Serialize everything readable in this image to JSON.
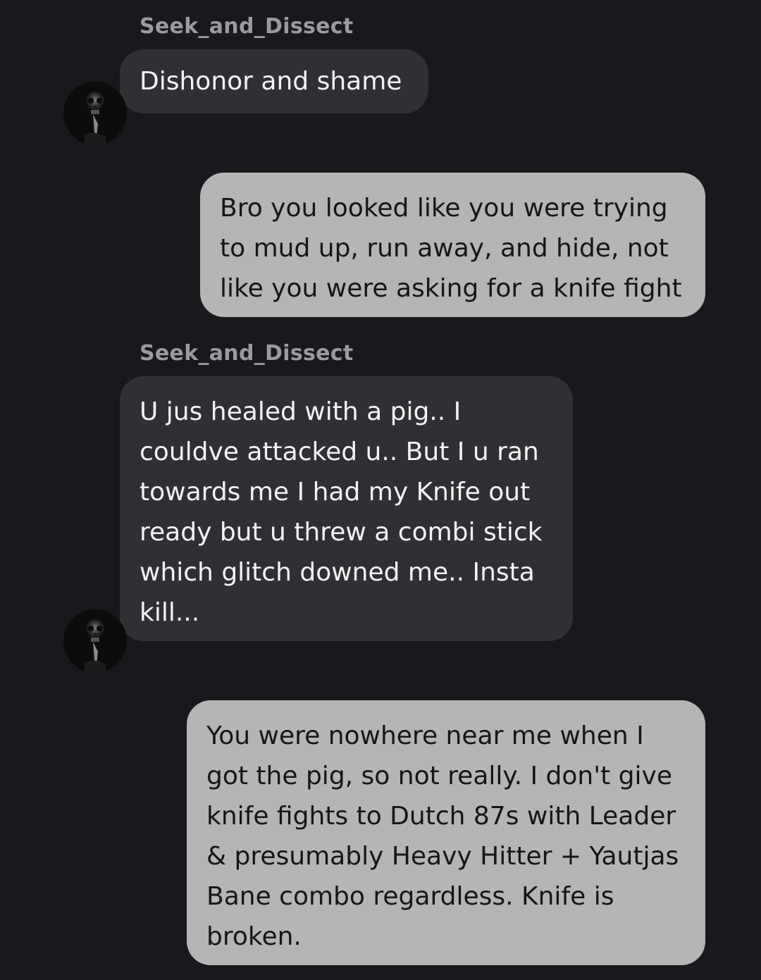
{
  "messages": [
    {
      "sender": "Seek_and_Dissect",
      "text": "Dishonor and shame",
      "direction": "incoming"
    },
    {
      "text": "Bro you looked like you were trying\nto mud up, run away, and hide, not\nlike you were asking for a knife fight",
      "direction": "outgoing"
    },
    {
      "sender": "Seek_and_Dissect",
      "text": "U jus healed with a pig.. I\ncouldve attacked u.. But I u ran\ntowards me I had my Knife out\nready but u threw a combi stick\nwhich glitch downed me.. Insta\nkill...",
      "direction": "incoming"
    },
    {
      "text": "You were nowhere near me when I\ngot the pig, so not really. I don't give\nknife fights to Dutch 87s with Leader\n& presumably Heavy Hitter + Yautjas\nBane combo regardless. Knife is\nbroken.",
      "direction": "outgoing"
    }
  ],
  "avatar": {
    "icon": "skull-shush-avatar"
  },
  "colors": {
    "background": "#18191c",
    "incoming_bubble": "#2f3034",
    "outgoing_bubble": "#b5b5b5",
    "sender_name": "#9a9b9f"
  }
}
